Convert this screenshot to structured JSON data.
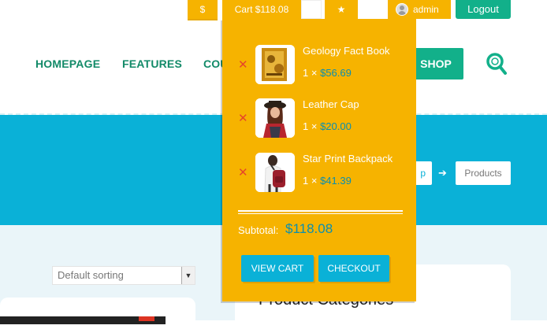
{
  "topbar": {
    "currency": "$",
    "cart": "Cart $118.08",
    "admin": "admin",
    "logout": "Logout"
  },
  "nav": {
    "homepage": "HOMEPAGE",
    "features": "FEATURES",
    "courses_partial": "COU",
    "shop": "SHOP"
  },
  "breadcrumb": {
    "prev_partial": "p",
    "current": "Products"
  },
  "sorting": {
    "selected": "Default sorting"
  },
  "sidebar": {
    "title": "Product Categories"
  },
  "cart_dropdown": {
    "items": [
      {
        "name": "Geology Fact Book",
        "quantity": "1 ×",
        "price": "$56.69"
      },
      {
        "name": "Leather Cap",
        "quantity": "1 ×",
        "price": "$20.00"
      },
      {
        "name": "Star Print Backpack",
        "quantity": "1 ×",
        "price": "$41.39"
      }
    ],
    "subtotal_label": "Subtotal:",
    "subtotal_value": "$118.08",
    "view_cart": "VIEW CART",
    "checkout": "CHECKOUT",
    "remove_symbol": "✕"
  },
  "icons": {
    "star": "★",
    "arrow": "➔",
    "select_arrow": "▼"
  },
  "colors": {
    "accent_yellow": "#f6b300",
    "accent_green": "#12b08a",
    "accent_blue": "#0ab1d7"
  }
}
